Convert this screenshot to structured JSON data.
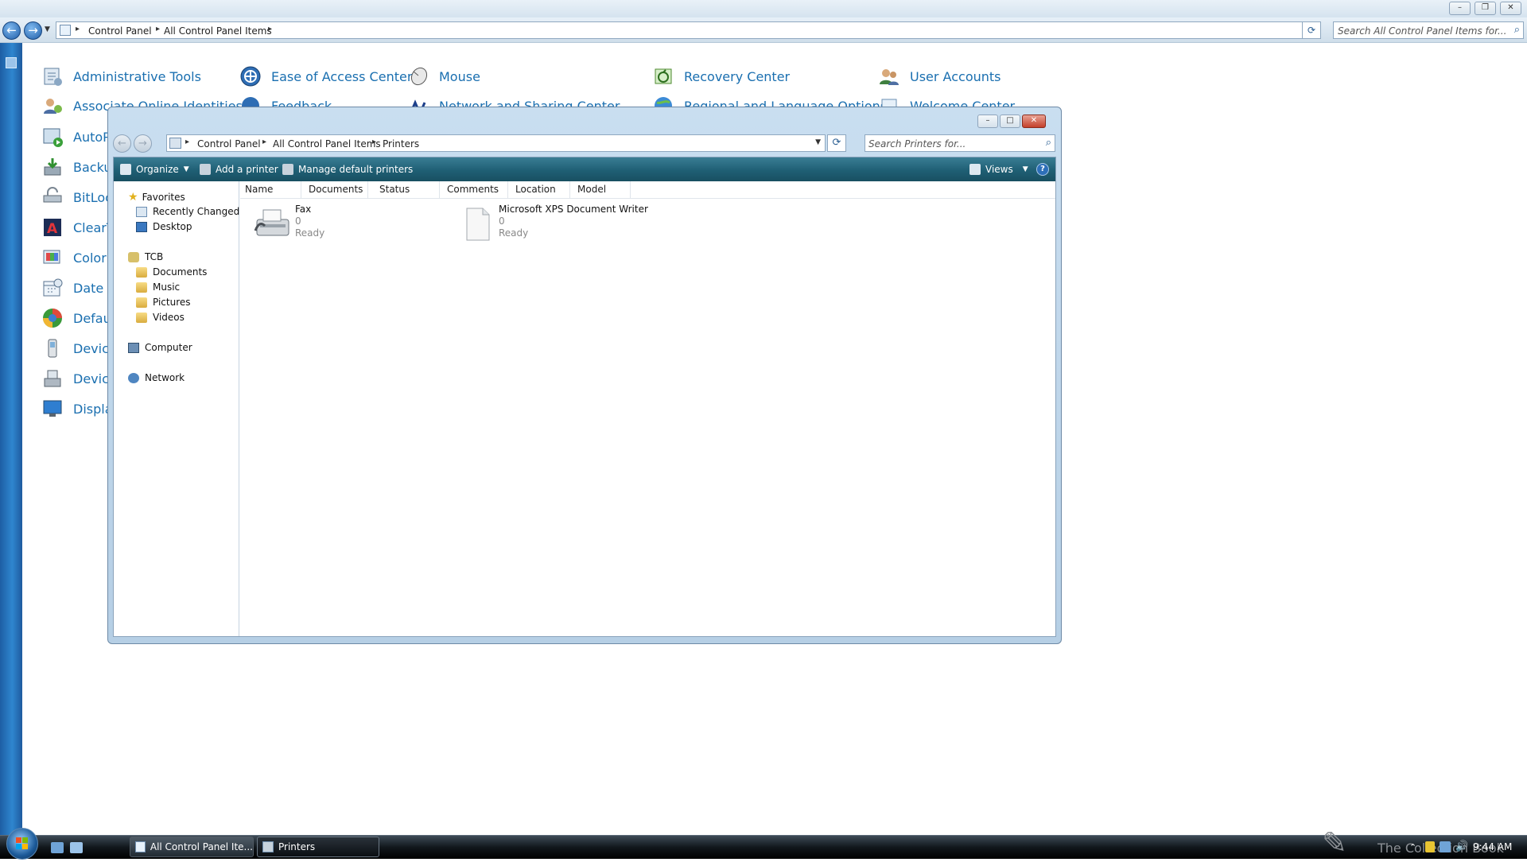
{
  "background_window": {
    "breadcrumb": [
      "Control Panel",
      "All Control Panel Items"
    ],
    "search_placeholder": "Search All Control Panel Items for...",
    "items": [
      {
        "label": "Administrative Tools",
        "icon": "admin-tools-icon"
      },
      {
        "label": "Ease of Access Center",
        "icon": "ease-of-access-icon"
      },
      {
        "label": "Mouse",
        "icon": "mouse-icon"
      },
      {
        "label": "Recovery Center",
        "icon": "recovery-icon"
      },
      {
        "label": "User Accounts",
        "icon": "user-accounts-icon"
      },
      {
        "label": "Associate Online Identities",
        "icon": "identities-icon"
      },
      {
        "label": "Feedback",
        "icon": "feedback-icon"
      },
      {
        "label": "Network and Sharing Center",
        "icon": "network-sharing-icon"
      },
      {
        "label": "Regional and Language Options",
        "icon": "regional-icon"
      },
      {
        "label": "Welcome Center",
        "icon": "welcome-icon"
      },
      {
        "label": "AutoP",
        "icon": "autoplay-icon"
      },
      {
        "label": "Backu",
        "icon": "backup-icon"
      },
      {
        "label": "BitLoc",
        "icon": "bitlocker-icon"
      },
      {
        "label": "ClearT",
        "icon": "cleartype-icon"
      },
      {
        "label": "Color",
        "icon": "color-icon"
      },
      {
        "label": "Date a",
        "icon": "date-time-icon"
      },
      {
        "label": "Defau",
        "icon": "default-programs-icon"
      },
      {
        "label": "Devic",
        "icon": "device-icon"
      },
      {
        "label": "Devic",
        "icon": "device-manager-icon"
      },
      {
        "label": "Displa",
        "icon": "display-icon"
      }
    ]
  },
  "printers_window": {
    "breadcrumb": [
      "Control Panel",
      "All Control Panel Items",
      "Printers"
    ],
    "search_placeholder": "Search Printers for...",
    "toolbar": {
      "organize": "Organize",
      "add_printer": "Add a printer",
      "manage_default": "Manage default printers",
      "views": "Views"
    },
    "sidebar": {
      "favorites": "Favorites",
      "recently_changed": "Recently Changed",
      "desktop": "Desktop",
      "user": "TCB",
      "documents": "Documents",
      "music": "Music",
      "pictures": "Pictures",
      "videos": "Videos",
      "computer": "Computer",
      "network": "Network"
    },
    "columns": [
      "Name",
      "Documents",
      "Status",
      "Comments",
      "Location",
      "Model"
    ],
    "printers": [
      {
        "name": "Fax",
        "documents": "0",
        "status": "Ready"
      },
      {
        "name": "Microsoft XPS Document Writer",
        "documents": "0",
        "status": "Ready"
      }
    ]
  },
  "taskbar": {
    "buttons": [
      "All Control Panel Ite...",
      "Printers"
    ],
    "clock": "9:44 AM",
    "watermark": "The Collection Book"
  }
}
